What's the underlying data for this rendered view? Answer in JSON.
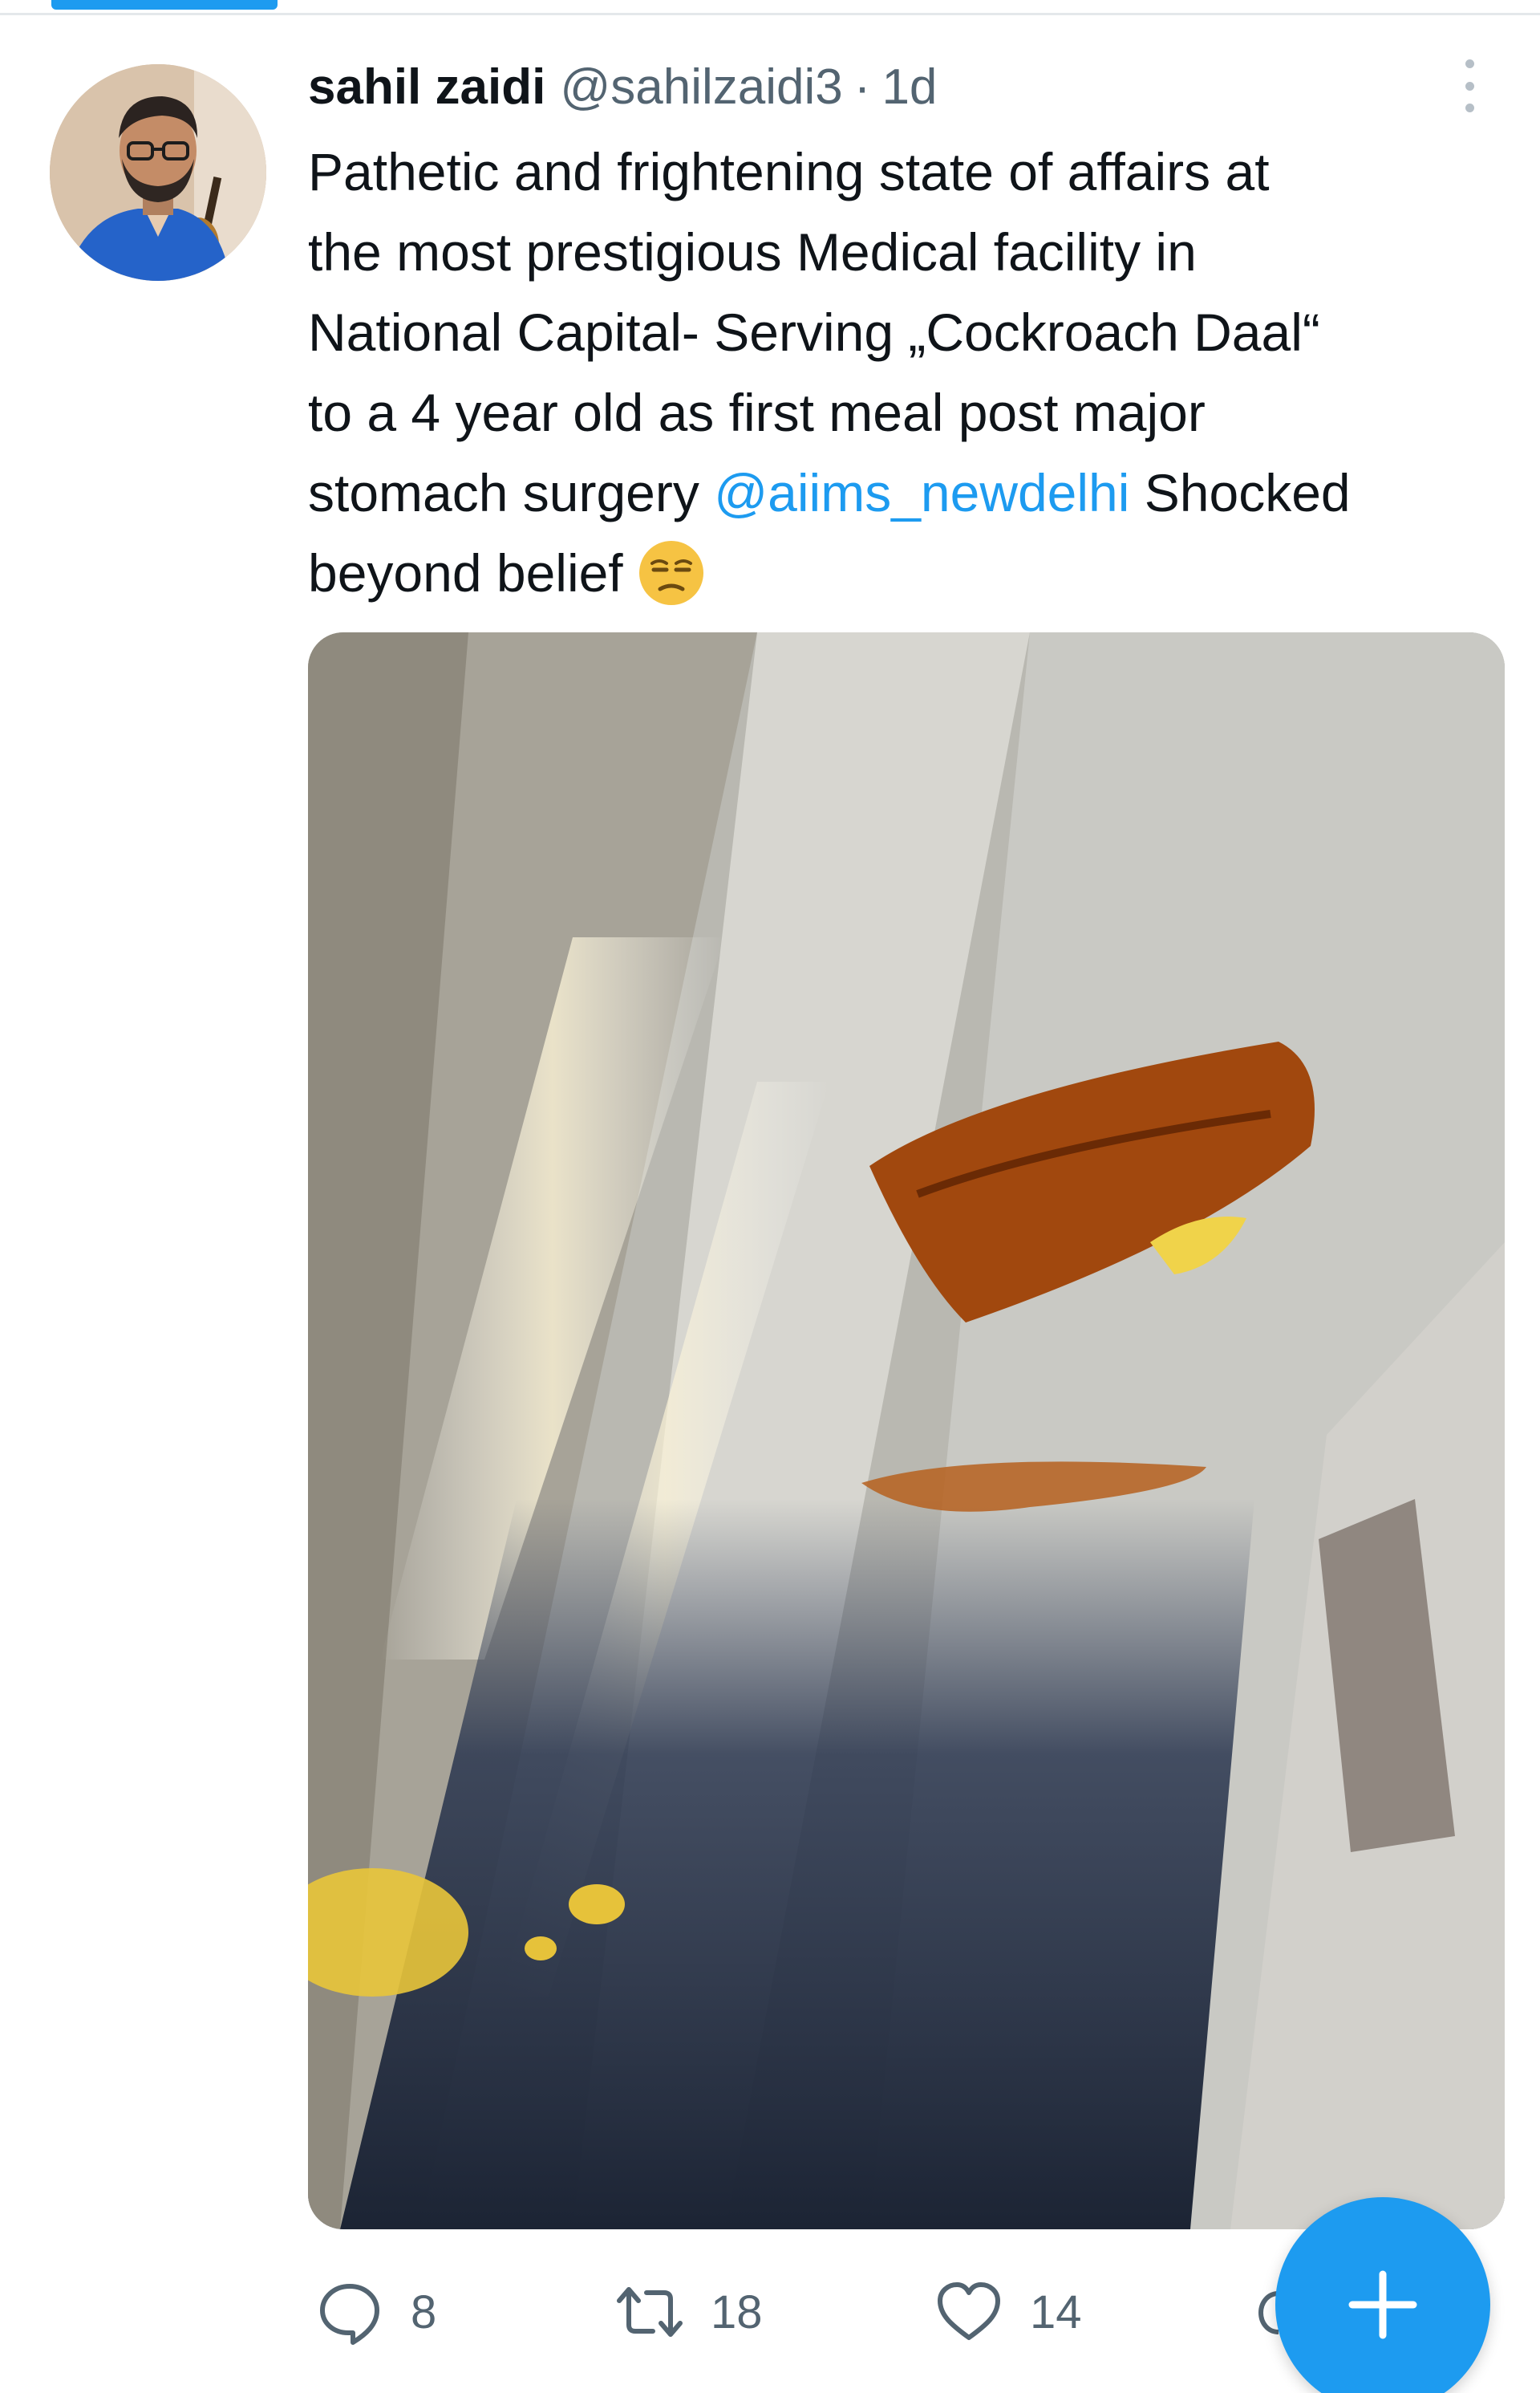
{
  "tweet": {
    "display_name": "sahil zaidi",
    "handle": "@sahilzaidi3",
    "separator": "·",
    "time": "1d",
    "text_lines": [
      "Pathetic and frightening state of affairs at",
      "the most prestigious Medical facility in",
      "National Capital- Serving „Cockroach Daal“",
      "to a 4 year old as first meal post major"
    ],
    "line5_before": "stomach surgery ",
    "mention": "@aiims_newdelhi",
    "line5_after": " Shocked",
    "line6": "beyond belief",
    "emoji": "unamused-face-emoji"
  },
  "actions": {
    "replies": "8",
    "retweets": "18",
    "likes": "14"
  },
  "colors": {
    "accent": "#1d9bf0",
    "text": "#0f1419",
    "muted": "#536471"
  }
}
